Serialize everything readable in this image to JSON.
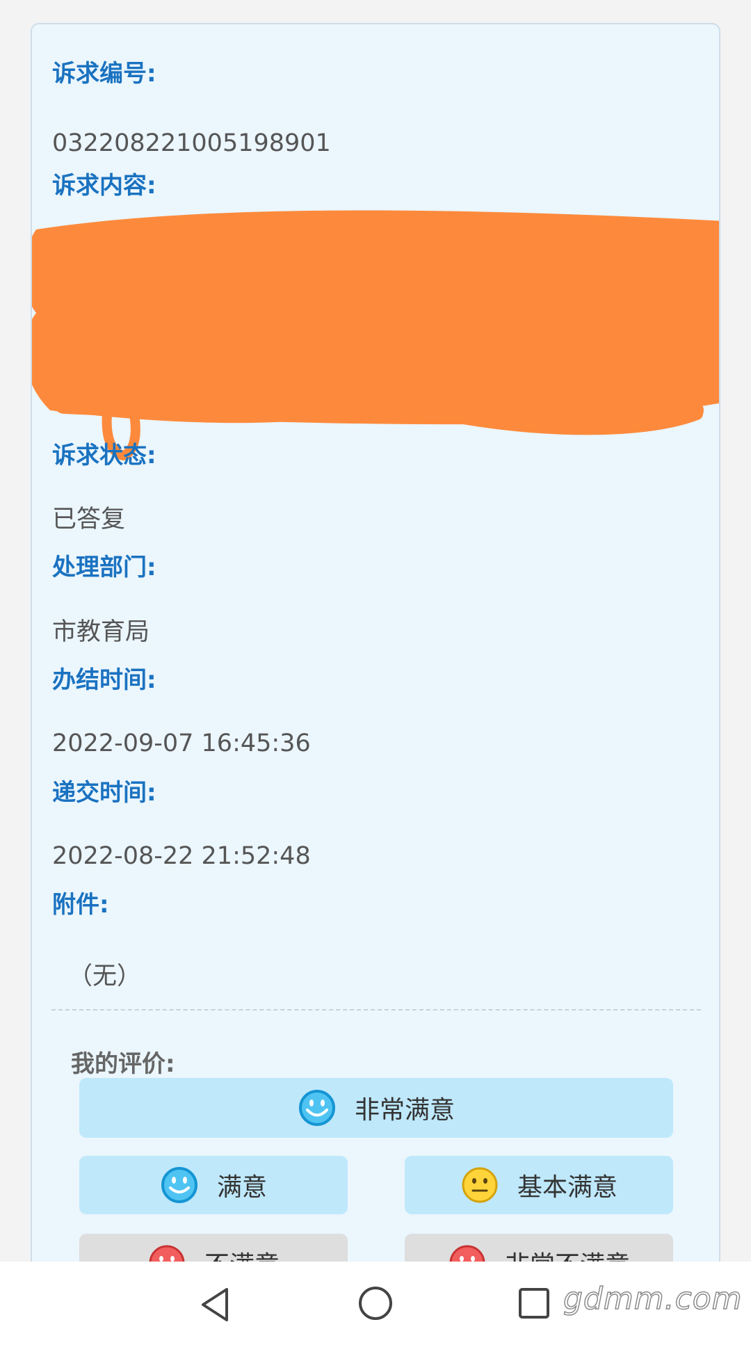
{
  "appeal": {
    "id_label": "诉求编号:",
    "id_value": "032208221005198901",
    "content_label": "诉求内容:",
    "status_label": "诉求状态:",
    "status_value": "已答复",
    "department_label": "处理部门:",
    "department_value": "市教育局",
    "completed_label": "办结时间:",
    "completed_value": "2022-09-07 16:45:36",
    "submitted_label": "递交时间:",
    "submitted_value": "2022-08-22 21:52:48",
    "attachment_label": "附件:",
    "attachment_value": "（无）"
  },
  "rating": {
    "title": "我的评价:",
    "options": [
      {
        "label": "非常满意",
        "icon": "very-satisfied-face-icon"
      },
      {
        "label": "满意",
        "icon": "satisfied-face-icon"
      },
      {
        "label": "基本满意",
        "icon": "neutral-face-icon"
      },
      {
        "label": "不满意",
        "icon": "dissatisfied-face-icon"
      },
      {
        "label": "非常不满意",
        "icon": "very-dissatisfied-face-icon"
      }
    ]
  },
  "navbar": {
    "icons": [
      "back-triangle-icon",
      "home-circle-icon",
      "recents-square-icon"
    ]
  },
  "watermark": "gdmm.com",
  "colors": {
    "label_blue": "#1a72c0",
    "card_bg": "#ebf6fd",
    "good_btn": "#bfe8fb",
    "bad_btn": "#dedede",
    "redaction_orange": "#fd8a3c"
  }
}
